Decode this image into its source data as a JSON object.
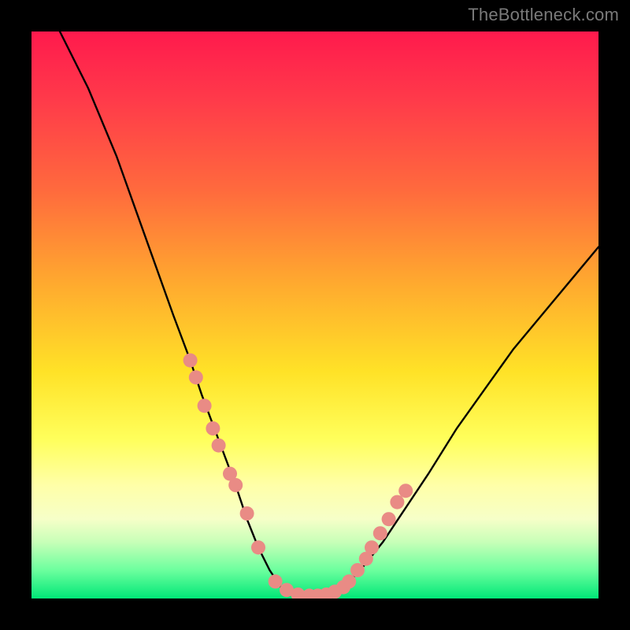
{
  "attribution": "TheBottleneck.com",
  "colors": {
    "background": "#000000",
    "gradient_top": "#ff1a4d",
    "gradient_mid1": "#ffa82f",
    "gradient_mid2": "#ffff5c",
    "gradient_bottom": "#00e777",
    "curve": "#000000",
    "marker_fill": "#e98b85",
    "marker_stroke": "#d76f69"
  },
  "chart_data": {
    "type": "line",
    "title": "",
    "xlabel": "",
    "ylabel": "",
    "xlim": [
      0,
      100
    ],
    "ylim": [
      0,
      100
    ],
    "grid": false,
    "series": [
      {
        "name": "bottleneck-curve",
        "x": [
          5,
          10,
          15,
          20,
          25,
          28,
          30,
          33,
          36,
          38,
          40,
          42,
          44,
          46,
          48,
          50,
          52,
          55,
          58,
          62,
          66,
          70,
          75,
          80,
          85,
          90,
          95,
          100
        ],
        "y": [
          100,
          90,
          78,
          64,
          50,
          42,
          36,
          28,
          20,
          14,
          9,
          5,
          2,
          1,
          0.5,
          0.5,
          1,
          2,
          5,
          10,
          16,
          22,
          30,
          37,
          44,
          50,
          56,
          62
        ]
      }
    ],
    "markers": {
      "name": "highlight-points",
      "x": [
        28,
        29,
        30.5,
        32,
        33,
        35,
        36,
        38,
        40,
        43,
        45,
        47,
        49,
        50.5,
        52,
        53.5,
        55,
        56,
        57.5,
        59,
        60,
        61.5,
        63,
        64.5,
        66
      ],
      "y": [
        42,
        39,
        34,
        30,
        27,
        22,
        20,
        15,
        9,
        3,
        1.5,
        0.7,
        0.5,
        0.5,
        0.7,
        1.2,
        2,
        3,
        5,
        7,
        9,
        11.5,
        14,
        17,
        19
      ]
    }
  }
}
